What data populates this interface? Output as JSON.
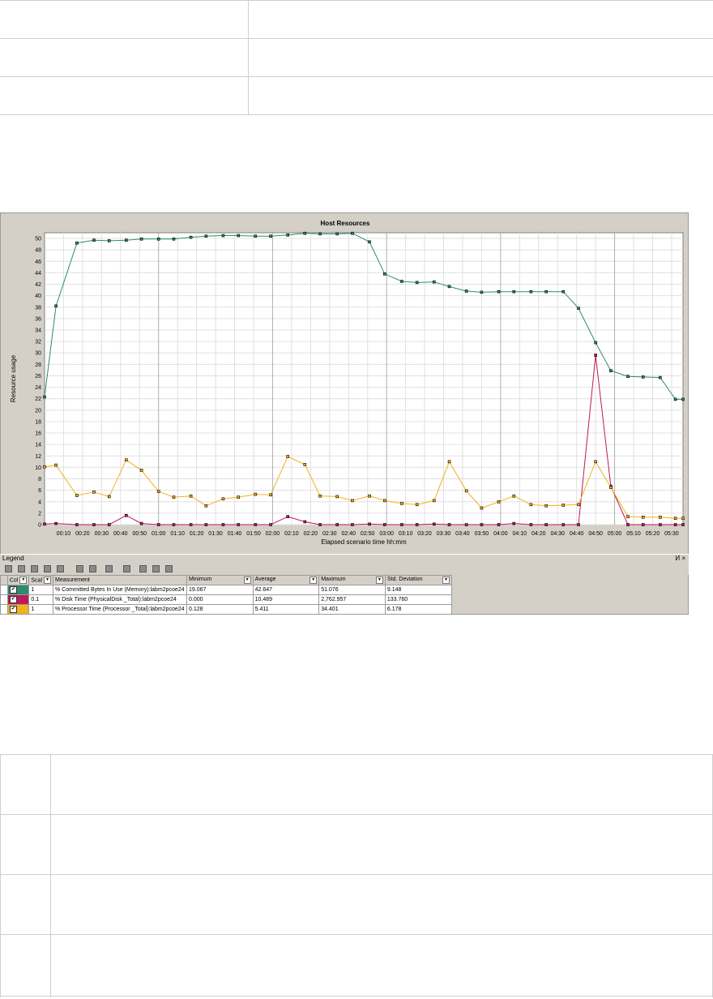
{
  "chart_data": {
    "type": "line",
    "title": "Host Resources",
    "xlabel": "Elapsed scenario time hh:mm",
    "ylabel": "Resource usage",
    "ylim": [
      0,
      51
    ],
    "yticks": [
      0,
      2,
      4,
      6,
      8,
      10,
      12,
      14,
      16,
      18,
      20,
      22,
      24,
      26,
      28,
      30,
      32,
      34,
      36,
      38,
      40,
      42,
      44,
      46,
      48,
      50
    ],
    "x": [
      "00:05",
      "00:10",
      "00:20",
      "00:30",
      "00:40",
      "00:50",
      "01:00",
      "01:10",
      "01:20",
      "01:30",
      "01:40",
      "01:50",
      "02:00",
      "02:10",
      "02:20",
      "02:30",
      "02:40",
      "02:50",
      "03:00",
      "03:10",
      "03:20",
      "03:30",
      "03:40",
      "03:50",
      "04:00",
      "04:10",
      "04:20",
      "04:30",
      "04:40",
      "04:50",
      "05:00",
      "05:10",
      "05:20",
      "05:30",
      "05:40"
    ],
    "x_minutes": [
      0,
      5,
      10,
      15,
      20,
      25,
      30,
      35,
      40,
      45,
      50,
      55,
      60,
      65,
      70,
      75,
      80,
      85,
      90,
      95,
      100,
      105,
      110,
      115,
      120,
      125,
      130,
      135,
      140,
      145,
      150,
      155,
      160,
      165,
      170,
      175,
      180,
      185,
      190,
      195,
      200,
      205,
      210,
      215,
      220,
      225,
      230,
      235,
      240,
      245,
      250,
      255,
      260,
      265,
      270,
      275,
      280,
      285,
      290,
      295,
      300,
      305,
      310,
      315,
      320,
      325,
      330,
      335,
      340,
      345,
      350
    ],
    "xticks": [
      "00:10",
      "00:20",
      "00:30",
      "00:40",
      "00:50",
      "01:00",
      "01:10",
      "01:20",
      "01:30",
      "01:40",
      "01:50",
      "02:00",
      "02:10",
      "02:20",
      "02:30",
      "02:40",
      "02:50",
      "03:00",
      "03:10",
      "03:20",
      "03:30",
      "03:40",
      "03:50",
      "04:00",
      "04:10",
      "04:20",
      "04:30",
      "04:40",
      "04:50",
      "05:00",
      "05:10",
      "05:20",
      "05:30"
    ],
    "xtick_minutes": [
      10,
      20,
      30,
      40,
      50,
      60,
      70,
      80,
      90,
      100,
      110,
      120,
      130,
      140,
      150,
      160,
      170,
      180,
      190,
      200,
      210,
      220,
      230,
      240,
      250,
      260,
      270,
      280,
      290,
      300,
      310,
      320,
      330
    ],
    "x_range_minutes": [
      0,
      336
    ],
    "grid": true,
    "series": [
      {
        "name": "% Committed Bytes In Use (Memory):labm2pcoe24",
        "color": "#2e8b6e",
        "x_minutes": [
          0,
          6,
          17,
          26,
          34,
          43,
          51,
          60,
          68,
          77,
          85,
          94,
          102,
          111,
          119,
          128,
          137,
          145,
          154,
          162,
          171,
          179,
          188,
          196,
          205,
          213,
          222,
          230,
          239,
          247,
          256,
          264,
          273,
          281,
          290,
          298,
          307,
          315,
          324,
          332,
          336
        ],
        "values": [
          22.3,
          38.2,
          49.2,
          49.7,
          49.6,
          49.7,
          49.9,
          49.9,
          49.9,
          50.2,
          50.4,
          50.5,
          50.5,
          50.4,
          50.4,
          50.6,
          50.9,
          50.8,
          50.8,
          50.9,
          49.4,
          43.8,
          42.5,
          42.3,
          42.4,
          41.6,
          40.8,
          40.6,
          40.7,
          40.7,
          40.7,
          40.7,
          40.7,
          37.8,
          31.8,
          26.9,
          25.9,
          25.8,
          25.7,
          21.9,
          21.9
        ]
      },
      {
        "name": "% Disk Time (PhysicalDisk _Total):labm2pcoe24",
        "color": "#c0185a",
        "x_minutes": [
          0,
          6,
          17,
          26,
          34,
          43,
          51,
          60,
          68,
          77,
          85,
          94,
          102,
          111,
          119,
          128,
          137,
          145,
          154,
          162,
          171,
          179,
          188,
          196,
          205,
          213,
          222,
          230,
          239,
          247,
          256,
          264,
          273,
          281,
          290,
          298,
          307,
          315,
          324,
          332,
          336
        ],
        "values": [
          0.1,
          0.2,
          0.0,
          0.0,
          0.0,
          1.6,
          0.2,
          0.0,
          0.0,
          0.0,
          0.0,
          0.0,
          0.0,
          0.0,
          0.0,
          1.4,
          0.5,
          0.0,
          0.0,
          0.0,
          0.1,
          0.0,
          0.0,
          0.0,
          0.1,
          0.0,
          0.0,
          0.0,
          0.0,
          0.2,
          0.0,
          0.0,
          0.0,
          0.0,
          29.6,
          6.7,
          0.0,
          0.0,
          0.0,
          0.0,
          0.0
        ]
      },
      {
        "name": "% Processor Time (Processor _Total):labm2pcoe24",
        "color": "#f2b21c",
        "x_minutes": [
          0,
          6,
          17,
          26,
          34,
          43,
          51,
          60,
          68,
          77,
          85,
          94,
          102,
          111,
          119,
          128,
          137,
          145,
          154,
          162,
          171,
          179,
          188,
          196,
          205,
          213,
          222,
          230,
          239,
          247,
          256,
          264,
          273,
          281,
          290,
          298,
          307,
          315,
          324,
          332,
          336
        ],
        "values": [
          10.1,
          10.4,
          5.1,
          5.7,
          4.9,
          11.3,
          9.5,
          5.8,
          4.8,
          5.0,
          3.3,
          4.5,
          4.8,
          5.3,
          5.2,
          11.9,
          10.5,
          5.0,
          4.9,
          4.2,
          5.0,
          4.2,
          3.7,
          3.5,
          4.2,
          11.0,
          5.9,
          2.9,
          4.0,
          5.0,
          3.5,
          3.3,
          3.4,
          3.5,
          11.0,
          6.5,
          1.4,
          1.3,
          1.3,
          1.1,
          1.1
        ]
      }
    ]
  },
  "legend": {
    "title": "Legend",
    "controls": "И ×",
    "headers": {
      "color": "Col",
      "scale": "Scal",
      "measurement": "Measurement",
      "minimum": "Minimum",
      "average": "Average",
      "maximum": "Maximum",
      "std": "Std. Deviation"
    },
    "rows": [
      {
        "color": "#2e8b6e",
        "scale": "1",
        "measurement": "% Committed Bytes In Use (Memory):labm2pcoe24",
        "minimum": "19.067",
        "average": "42.647",
        "maximum": "51.076",
        "std": "9.148"
      },
      {
        "color": "#c0185a",
        "scale": "0.1",
        "measurement": "% Disk Time (PhysicalDisk _Total):labm2pcoe24",
        "minimum": "0.000",
        "average": "10.489",
        "maximum": "2,762.957",
        "std": "133.760"
      },
      {
        "color": "#f2b21c",
        "scale": "1",
        "measurement": "% Processor Time (Processor _Total):labm2pcoe24",
        "minimum": "0.128",
        "average": "5.411",
        "maximum": "34.401",
        "std": "6.178"
      }
    ]
  }
}
